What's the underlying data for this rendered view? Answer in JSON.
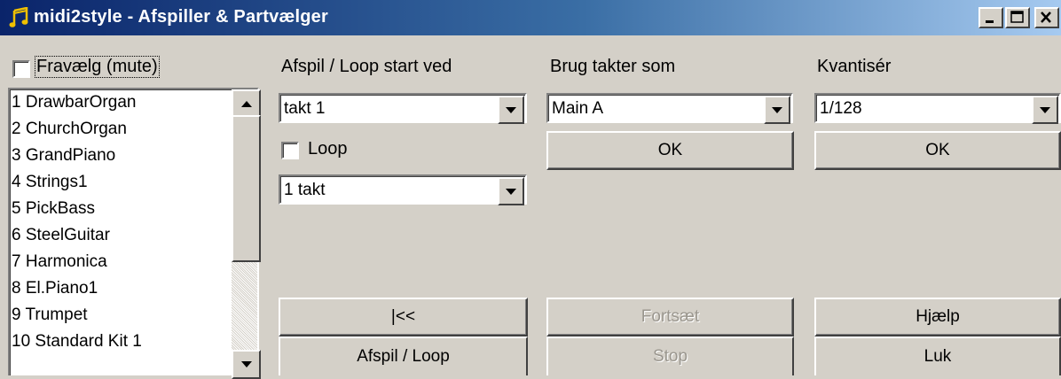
{
  "window": {
    "title": "midi2style - Afspiller & Partvælger",
    "app_icon": "music-note-icon",
    "caption_buttons": [
      "minimize-icon",
      "maximize-icon",
      "close-icon"
    ]
  },
  "mute": {
    "label": "Fravælg (mute)",
    "checked": false
  },
  "tracks": {
    "items": [
      "1 DrawbarOrgan",
      "2 ChurchOrgan",
      "3 GrandPiano",
      "4 Strings1",
      "5 PickBass",
      "6 SteelGuitar",
      "7 Harmonica",
      "8 El.Piano1",
      "9 Trumpet",
      "10 Standard Kit 1"
    ]
  },
  "playback": {
    "heading": "Afspil / Loop start ved",
    "start_value": "takt 1",
    "loop_label": "Loop",
    "loop_checked": false,
    "length_value": "1 takt",
    "rewind_label": "|<<",
    "play_label": "Afspil / Loop"
  },
  "bars": {
    "heading": "Brug takter som",
    "value": "Main A",
    "ok_label": "OK",
    "continue_label": "Fortsæt",
    "stop_label": "Stop"
  },
  "quantize": {
    "heading": "Kvantisér",
    "value": "1/128",
    "ok_label": "OK",
    "help_label": "Hjælp",
    "close_label": "Luk"
  },
  "colors": {
    "face": "#d4d0c8",
    "titlebar_start": "#0a246a",
    "titlebar_end": "#a6caf0",
    "disabled_text": "#9a968e"
  }
}
